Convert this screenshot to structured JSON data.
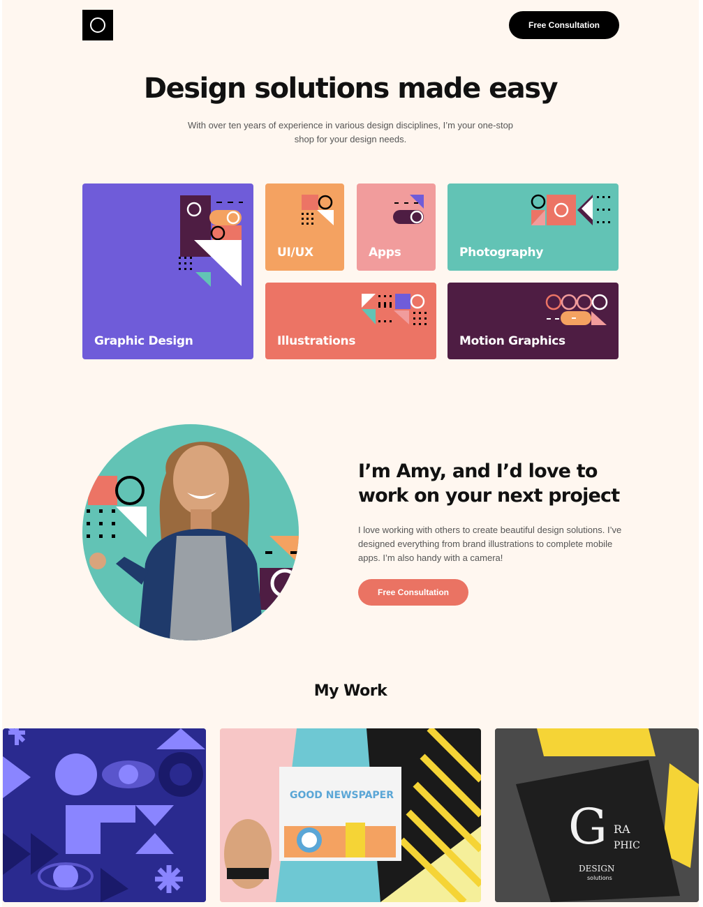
{
  "header": {
    "logo_icon": "ring-icon",
    "cta_label": "Free Consultation"
  },
  "hero": {
    "title": "Design solutions made easy",
    "subtitle": "With over ten years of experience in various design disciplines, I’m your one-stop shop for your design needs."
  },
  "services": [
    {
      "label": "Graphic Design",
      "color": "#6f5cd9"
    },
    {
      "label": "UI/UX",
      "color": "#f4a261"
    },
    {
      "label": "Apps",
      "color": "#f19c9c"
    },
    {
      "label": "Photography",
      "color": "#62c3b5"
    },
    {
      "label": "Illustrations",
      "color": "#ec7465"
    },
    {
      "label": "Motion Graphics",
      "color": "#4e1d43"
    }
  ],
  "about": {
    "title": "I’m Amy, and I’d love to work on your next project",
    "text": "I love working with others to create beautiful design solutions. I’ve designed everything from brand illustrations to complete mobile apps. I’m also handy with a camera!",
    "cta_label": "Free Consultation"
  },
  "work": {
    "title": "My Work",
    "items": [
      {
        "name": "geometric-pattern"
      },
      {
        "name": "newspaper",
        "text": "NEWSPAPER"
      },
      {
        "name": "graphic-design-book",
        "text": "GRAPHIC DESIGN solutions"
      }
    ]
  },
  "colors": {
    "background": "#fff7f0",
    "accent": "#ea7363",
    "dark": "#000000"
  }
}
